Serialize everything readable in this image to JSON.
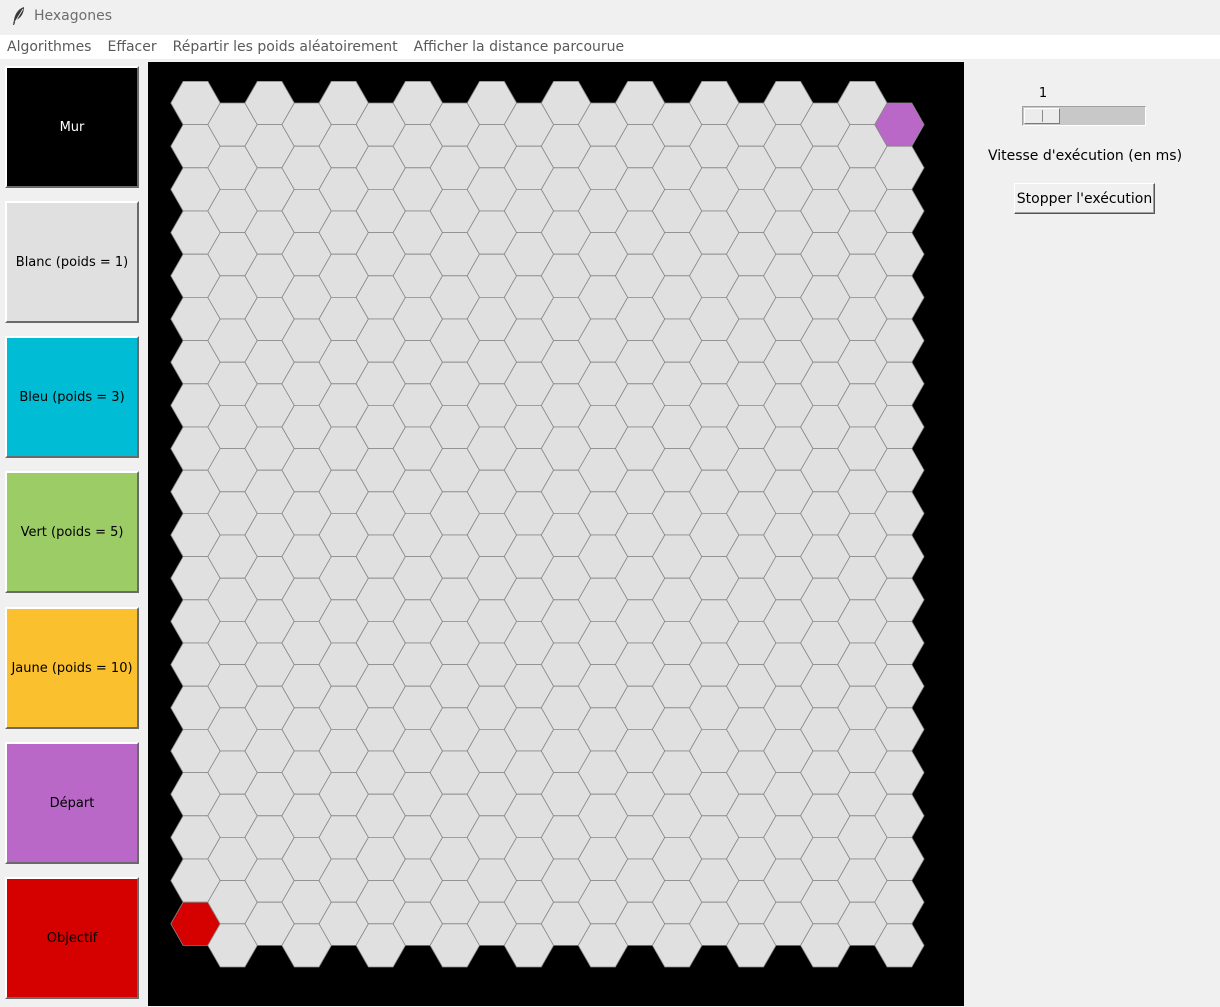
{
  "window": {
    "title": "Hexagones",
    "icon": "feather-icon"
  },
  "menubar": {
    "items": [
      "Algorithmes",
      "Effacer",
      "Répartir les poids aléatoirement",
      "Afficher la distance parcourue"
    ]
  },
  "palette": {
    "buttons": [
      {
        "label": "Mur",
        "color": "#000000",
        "text_color": "#ffffff"
      },
      {
        "label": "Blanc (poids = 1)",
        "color": "#e0e0e0",
        "text_color": "#000000"
      },
      {
        "label": "Bleu (poids = 3)",
        "color": "#00bcd4",
        "text_color": "#000000"
      },
      {
        "label": "Vert (poids = 5)",
        "color": "#9ccc65",
        "text_color": "#000000"
      },
      {
        "label": "Jaune (poids = 10)",
        "color": "#fbc02d",
        "text_color": "#000000"
      },
      {
        "label": "Départ",
        "color": "#ba68c8",
        "text_color": "#000000"
      },
      {
        "label": "Objectif",
        "color": "#d50000",
        "text_color": "#000000"
      }
    ]
  },
  "board": {
    "background": "#000000",
    "cell_color": "#e0e0e0",
    "cell_border": "#888888",
    "columns": 20,
    "rows": 20,
    "start_cell": {
      "col": 19,
      "row": 0,
      "color": "#ba68c8"
    },
    "goal_cell": {
      "col": 0,
      "row": 19,
      "color": "#d50000"
    }
  },
  "speed": {
    "value": "1",
    "label": "Vitesse d'exécution (en ms)"
  },
  "stop_button": {
    "label": "Stopper l'exécution"
  }
}
